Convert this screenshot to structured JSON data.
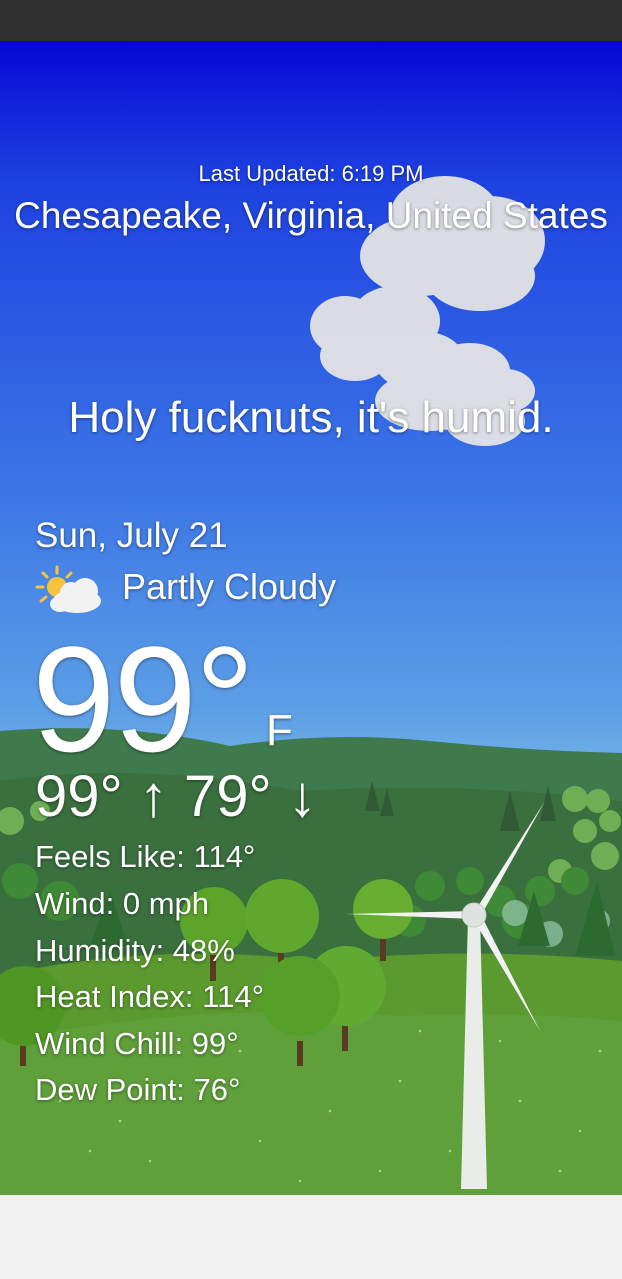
{
  "header": {
    "last_updated": "Last Updated: 6:19 PM",
    "location": "Chesapeake, Virginia, United States"
  },
  "tagline": "Holy fucknuts, it's humid.",
  "current": {
    "date": "Sun, July 21",
    "condition": "Partly Cloudy",
    "condition_icon": "partly-cloudy-icon",
    "temperature": "99°",
    "unit": "F",
    "high_low": "99° ↑ 79° ↓"
  },
  "details": [
    "Feels Like: 114°",
    "Wind: 0 mph",
    "Humidity: 48%",
    "Heat Index: 114°",
    "Wind Chill: 99°",
    "Dew Point: 76°"
  ],
  "colors": {
    "sky_top": "#0707d6",
    "sky_bottom": "#88c2ea",
    "grass": "#5a9a2c",
    "status_bar": "#303030"
  }
}
